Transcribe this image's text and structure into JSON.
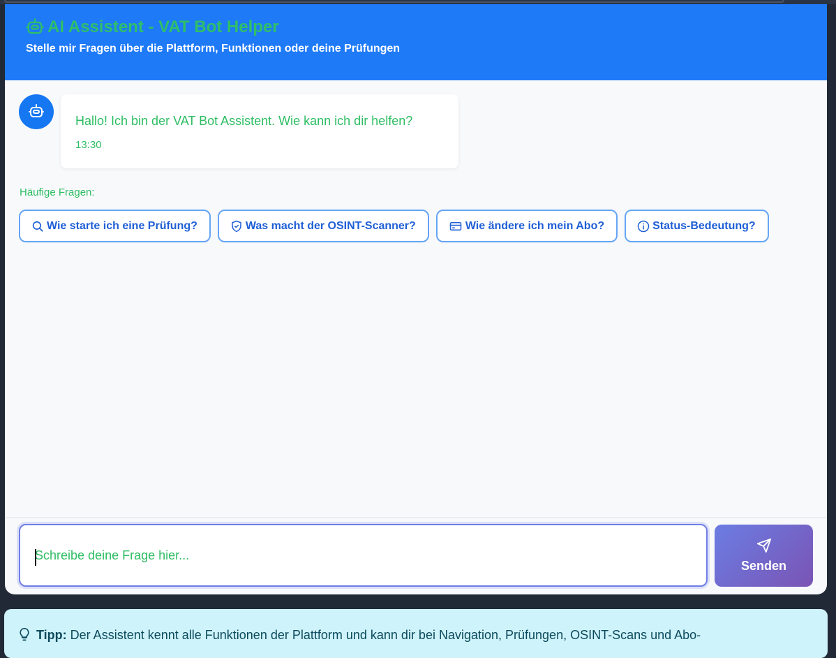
{
  "header": {
    "title": "AI Assistent - VAT Bot Helper",
    "subtitle": "Stelle mir Fragen über die Plattform, Funktionen oder deine Prüfungen",
    "icon": "robot-icon"
  },
  "chat": {
    "messages": [
      {
        "sender": "bot",
        "text": "Hallo! Ich bin der VAT Bot Assistent. Wie kann ich dir helfen?",
        "time": "13:30"
      }
    ]
  },
  "faq": {
    "label": "Häufige Fragen:",
    "items": [
      {
        "label": "Wie starte ich eine Prüfung?",
        "icon": "search-icon"
      },
      {
        "label": "Was macht der OSINT-Scanner?",
        "icon": "shield-icon"
      },
      {
        "label": "Wie ändere ich mein Abo?",
        "icon": "credit-card-icon"
      },
      {
        "label": "Status-Bedeutung?",
        "icon": "info-icon"
      }
    ]
  },
  "composer": {
    "placeholder": "Schreibe deine Frage hier...",
    "send_label": "Senden"
  },
  "tip": {
    "label": "Tipp:",
    "text": "Der Assistent kennt alle Funktionen der Plattform und kann dir bei Navigation, Prüfungen, OSINT-Scans und Abo-"
  },
  "colors": {
    "header_bg": "#1e7af7",
    "accent_green": "#2ebd63",
    "chip_blue": "#1f5fd6",
    "send_gradient_start": "#6b7de3",
    "send_gradient_end": "#7a54b4",
    "tip_bg": "#cff3fb"
  }
}
